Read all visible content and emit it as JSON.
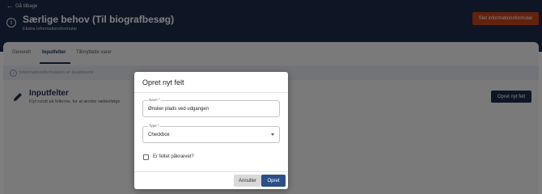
{
  "header": {
    "back_label": "Gå tilbage",
    "title": "Særlige behov (Til biografbesøg)",
    "subtitle": "Ekstra informationsformular",
    "delete_button": "Slet informationsformular"
  },
  "tabs": [
    {
      "label": "Generelt",
      "active": false
    },
    {
      "label": "Inputfelter",
      "active": true
    },
    {
      "label": "Tilknyttede varer",
      "active": false
    }
  ],
  "notice": {
    "text": "Informationsformularen er deaktiveret"
  },
  "section": {
    "title": "Inputfelter",
    "subtitle": "Flyt rundt på felterne, for at ændre rækkefølge",
    "create_button": "Opret nyt felt"
  },
  "dialog": {
    "title": "Opret nyt felt",
    "name_label": "Navn *",
    "name_value": "Ønsker plads ved udgangen",
    "type_label": "Type *",
    "type_value": "Checkbox",
    "required_label": "Er feltet påkrævet?",
    "required_checked": false,
    "cancel_button": "Annuller",
    "submit_button": "Opret"
  },
  "colors": {
    "header_bg": "#1c2c4a",
    "danger": "#c4441b",
    "primary": "#2b5087"
  }
}
